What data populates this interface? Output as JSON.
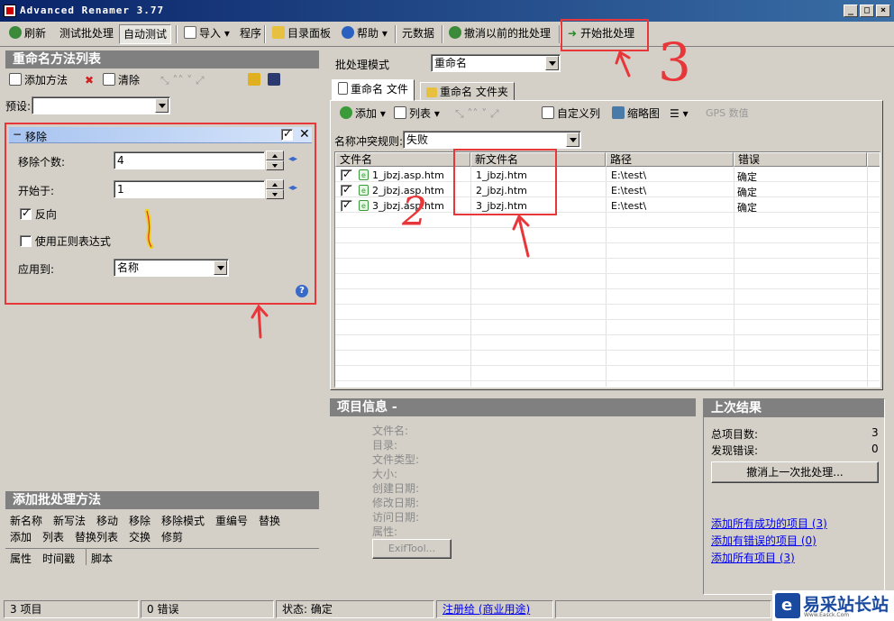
{
  "window": {
    "title": "Advanced Renamer 3.77"
  },
  "toolbar": {
    "refresh": "刷新",
    "test_batch": "测试批处理",
    "auto_test": "自动测试",
    "import": "导入",
    "program": "程序",
    "dir_panel": "目录面板",
    "help": "帮助",
    "metadata": "元数据",
    "undo_previous": "撤消以前的批处理",
    "start_batch": "开始批处理"
  },
  "left": {
    "methods_title": "重命名方法列表",
    "add_method": "添加方法",
    "clear": "清除",
    "preset_label": "预设:",
    "preset_value": "",
    "method_panel": {
      "title": "移除",
      "remove_count_label": "移除个数:",
      "remove_count": "4",
      "start_at_label": "开始于:",
      "start_at": "1",
      "reverse_label": "反向",
      "regex_label": "使用正则表达式",
      "apply_to_label": "应用到:",
      "apply_to_value": "名称"
    },
    "add_batch_title": "添加批处理方法",
    "batch_methods_row1": [
      "新名称",
      "新写法",
      "移动",
      "移除",
      "移除模式",
      "重编号",
      "替换"
    ],
    "batch_methods_row2": [
      "添加",
      "列表",
      "替换列表",
      "交换",
      "修剪"
    ],
    "batch_methods_row3": [
      "属性",
      "时间戳",
      "脚本"
    ]
  },
  "right": {
    "batch_mode_label": "批处理模式",
    "batch_mode_value": "重命名",
    "tabs": [
      "重命名 文件",
      "重命名 文件夹"
    ],
    "file_toolbar": {
      "add": "添加",
      "list": "列表",
      "custom_columns": "自定义列",
      "thumbnail": "缩略图",
      "gps": "GPS 数值"
    },
    "conflict_label": "名称冲突规则:",
    "conflict_value": "失败",
    "columns": [
      "文件名",
      "新文件名",
      "路径",
      "错误"
    ],
    "rows": [
      {
        "file": "1_jbzj.asp.htm",
        "new": "1_jbzj.htm",
        "path": "E:\\test\\",
        "error": "确定"
      },
      {
        "file": "2_jbzj.asp.htm",
        "new": "2_jbzj.htm",
        "path": "E:\\test\\",
        "error": "确定"
      },
      {
        "file": "3_jbzj.asp.htm",
        "new": "3_jbzj.htm",
        "path": "E:\\test\\",
        "error": "确定"
      }
    ],
    "item_info": {
      "title": "项目信息 -",
      "fields": [
        "文件名:",
        "目录:",
        "文件类型:",
        "大小:",
        "创建日期:",
        "修改日期:",
        "访问日期:",
        "属性:"
      ],
      "exiftool": "ExifTool..."
    },
    "last_result": {
      "title": "上次结果",
      "total_label": "总项目数:",
      "total": "3",
      "errors_label": "发现错误:",
      "errors": "0",
      "undo_last": "撤消上一次批处理...",
      "links": [
        "添加所有成功的项目 (3)",
        "添加有错误的项目 (0)",
        "添加所有项目 (3)"
      ]
    }
  },
  "status": {
    "items": "3 项目",
    "errors": "0 错误",
    "state": "状态: 确定",
    "register": "注册给 (商业用途)"
  },
  "annotations": {
    "n1": "1",
    "n2": "2",
    "n3": "3"
  },
  "watermark": {
    "text": "易采站长站",
    "sub": "Www.Easck.Com"
  }
}
